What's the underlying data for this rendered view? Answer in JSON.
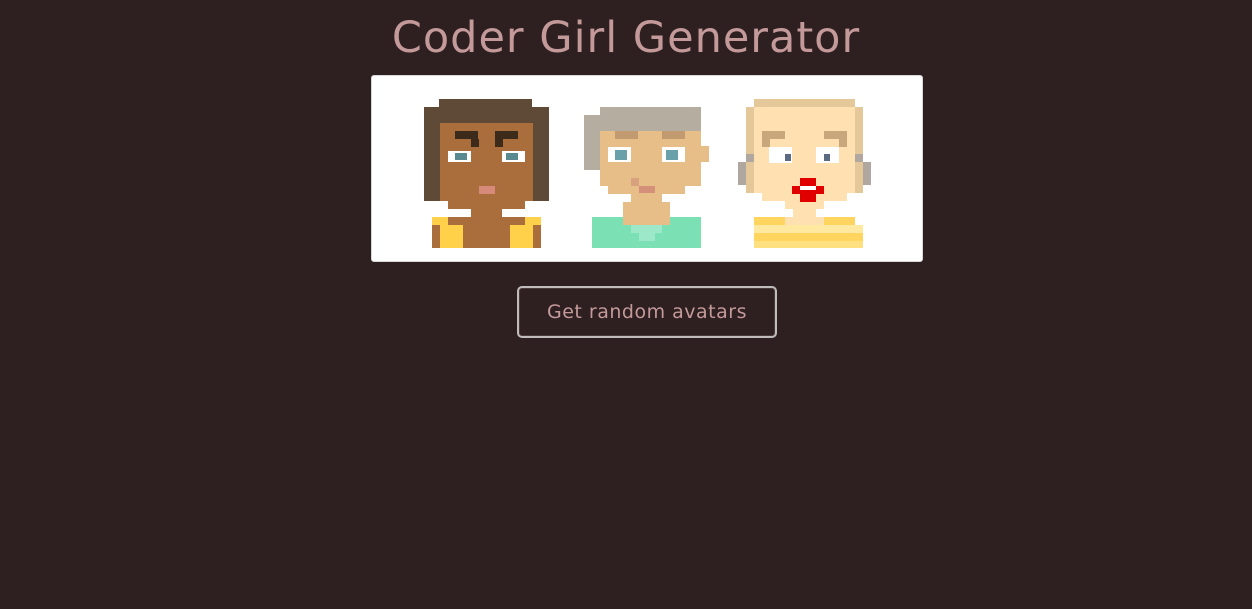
{
  "page": {
    "title": "Coder Girl Generator",
    "background_color": "#2e2021",
    "accent_color": "#c4999a"
  },
  "avatars": [
    {
      "label": "avatar-1",
      "skin": "#a96e3c",
      "hair": "#5e4a36",
      "shirt": "#ffd04a"
    },
    {
      "label": "avatar-2",
      "skin": "#e7bd88",
      "hair": "#b5ad9f",
      "shirt": "#7be0b4"
    },
    {
      "label": "avatar-3",
      "skin": "#ffe0b0",
      "hair": "#e4c89a",
      "shirt": "#ffd560",
      "lips": "#e00000"
    }
  ],
  "actions": {
    "random_label": "Get random avatars"
  }
}
